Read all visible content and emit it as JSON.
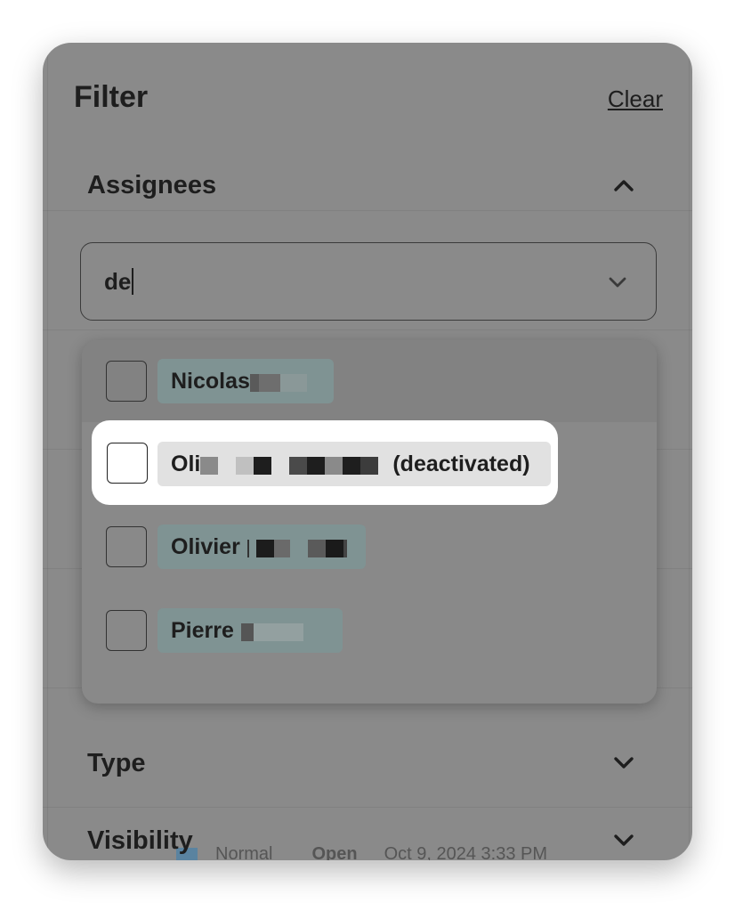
{
  "filter": {
    "title": "Filter",
    "clear_label": "Clear"
  },
  "assignees": {
    "label": "Assignees",
    "expanded": true,
    "search_value": "de",
    "options": [
      {
        "name": "Nicolas",
        "checked": false
      },
      {
        "name": "Oli",
        "suffix": "(deactivated)",
        "checked": false,
        "highlighted": true
      },
      {
        "name": "Olivier",
        "checked": false
      },
      {
        "name": "Pierre",
        "checked": false
      }
    ]
  },
  "sections": {
    "type_label": "Type",
    "visibility_label": "Visibility"
  },
  "background": {
    "row_text": "Normal",
    "row_status": "Open",
    "row_date": "Oct 9, 2024 3:33 PM"
  },
  "icons": [
    "chevron-up-icon",
    "chevron-down-icon",
    "checkbox-icon"
  ],
  "colors": {
    "overlay": "#8a8a8a",
    "chip": "#7f9393",
    "highlight": "#ffffff",
    "text": "#1e1e1e"
  }
}
